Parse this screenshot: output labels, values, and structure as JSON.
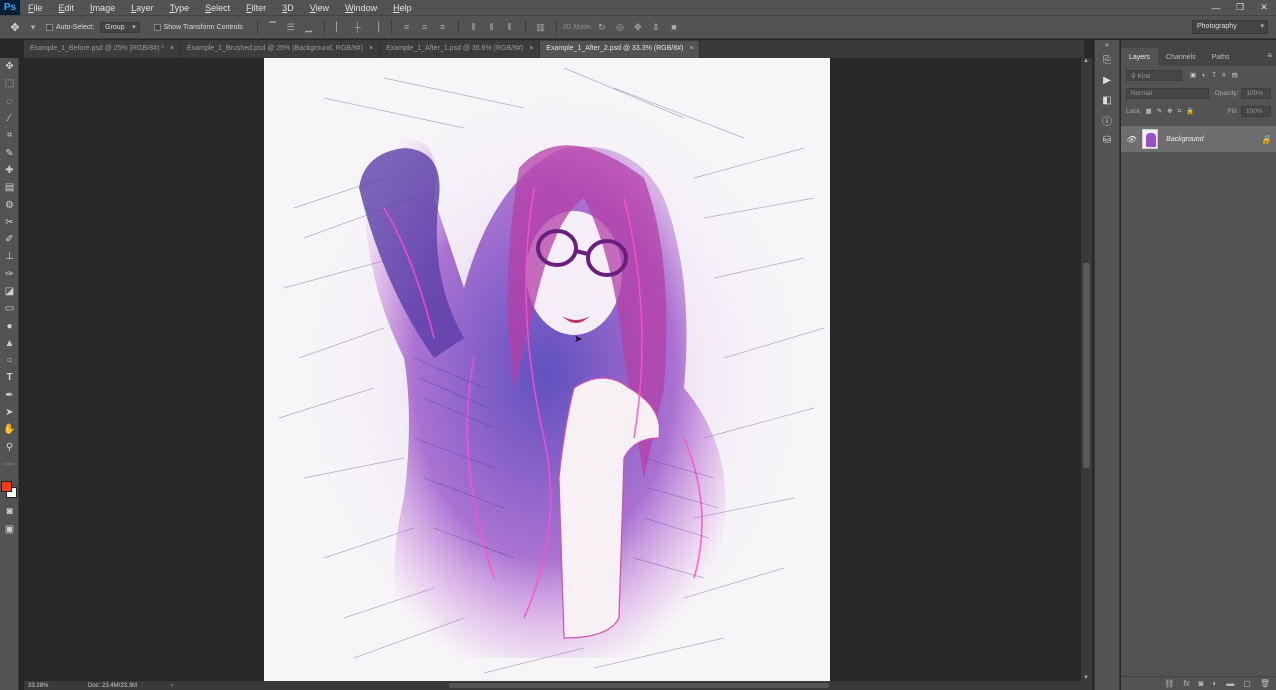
{
  "app": {
    "logo": "Ps"
  },
  "menu": [
    "File",
    "Edit",
    "Image",
    "Layer",
    "Type",
    "Select",
    "Filter",
    "3D",
    "View",
    "Window",
    "Help"
  ],
  "window_controls": [
    "—",
    "❐",
    "✕"
  ],
  "options_bar": {
    "auto_select_label": "Auto-Select:",
    "auto_select_value": "Group",
    "transform_label": "Show Transform Controls",
    "mode_3d_label": "3D Mode:",
    "workspace": "Photography"
  },
  "tabs": [
    {
      "label": "Example_1_Before.psd @ 25% (RGB/8#) *"
    },
    {
      "label": "Example_1_Brushed.psd @ 25% (Background, RGB/8#)"
    },
    {
      "label": "Example_1_After_1.psd @ 36.6% (RGB/8#)"
    },
    {
      "label": "Example_1_After_2.psd @ 33.3% (RGB/8#)"
    }
  ],
  "active_tab": 3,
  "status": {
    "zoom": "33.28%",
    "doc": "Doc: 23.4M/23.3M"
  },
  "layers_panel": {
    "tabs": [
      "Layers",
      "Channels",
      "Paths"
    ],
    "kind_placeholder": "Kind",
    "blend_mode": "Normal",
    "opacity_label": "Opacity:",
    "opacity_value": "100%",
    "lock_label": "Lock:",
    "fill_label": "Fill:",
    "fill_value": "100%",
    "layer_name": "Background"
  },
  "colors": {
    "foreground": "#ff3b10",
    "background": "#ffffff",
    "artwork_accent": "#c93aa8"
  }
}
